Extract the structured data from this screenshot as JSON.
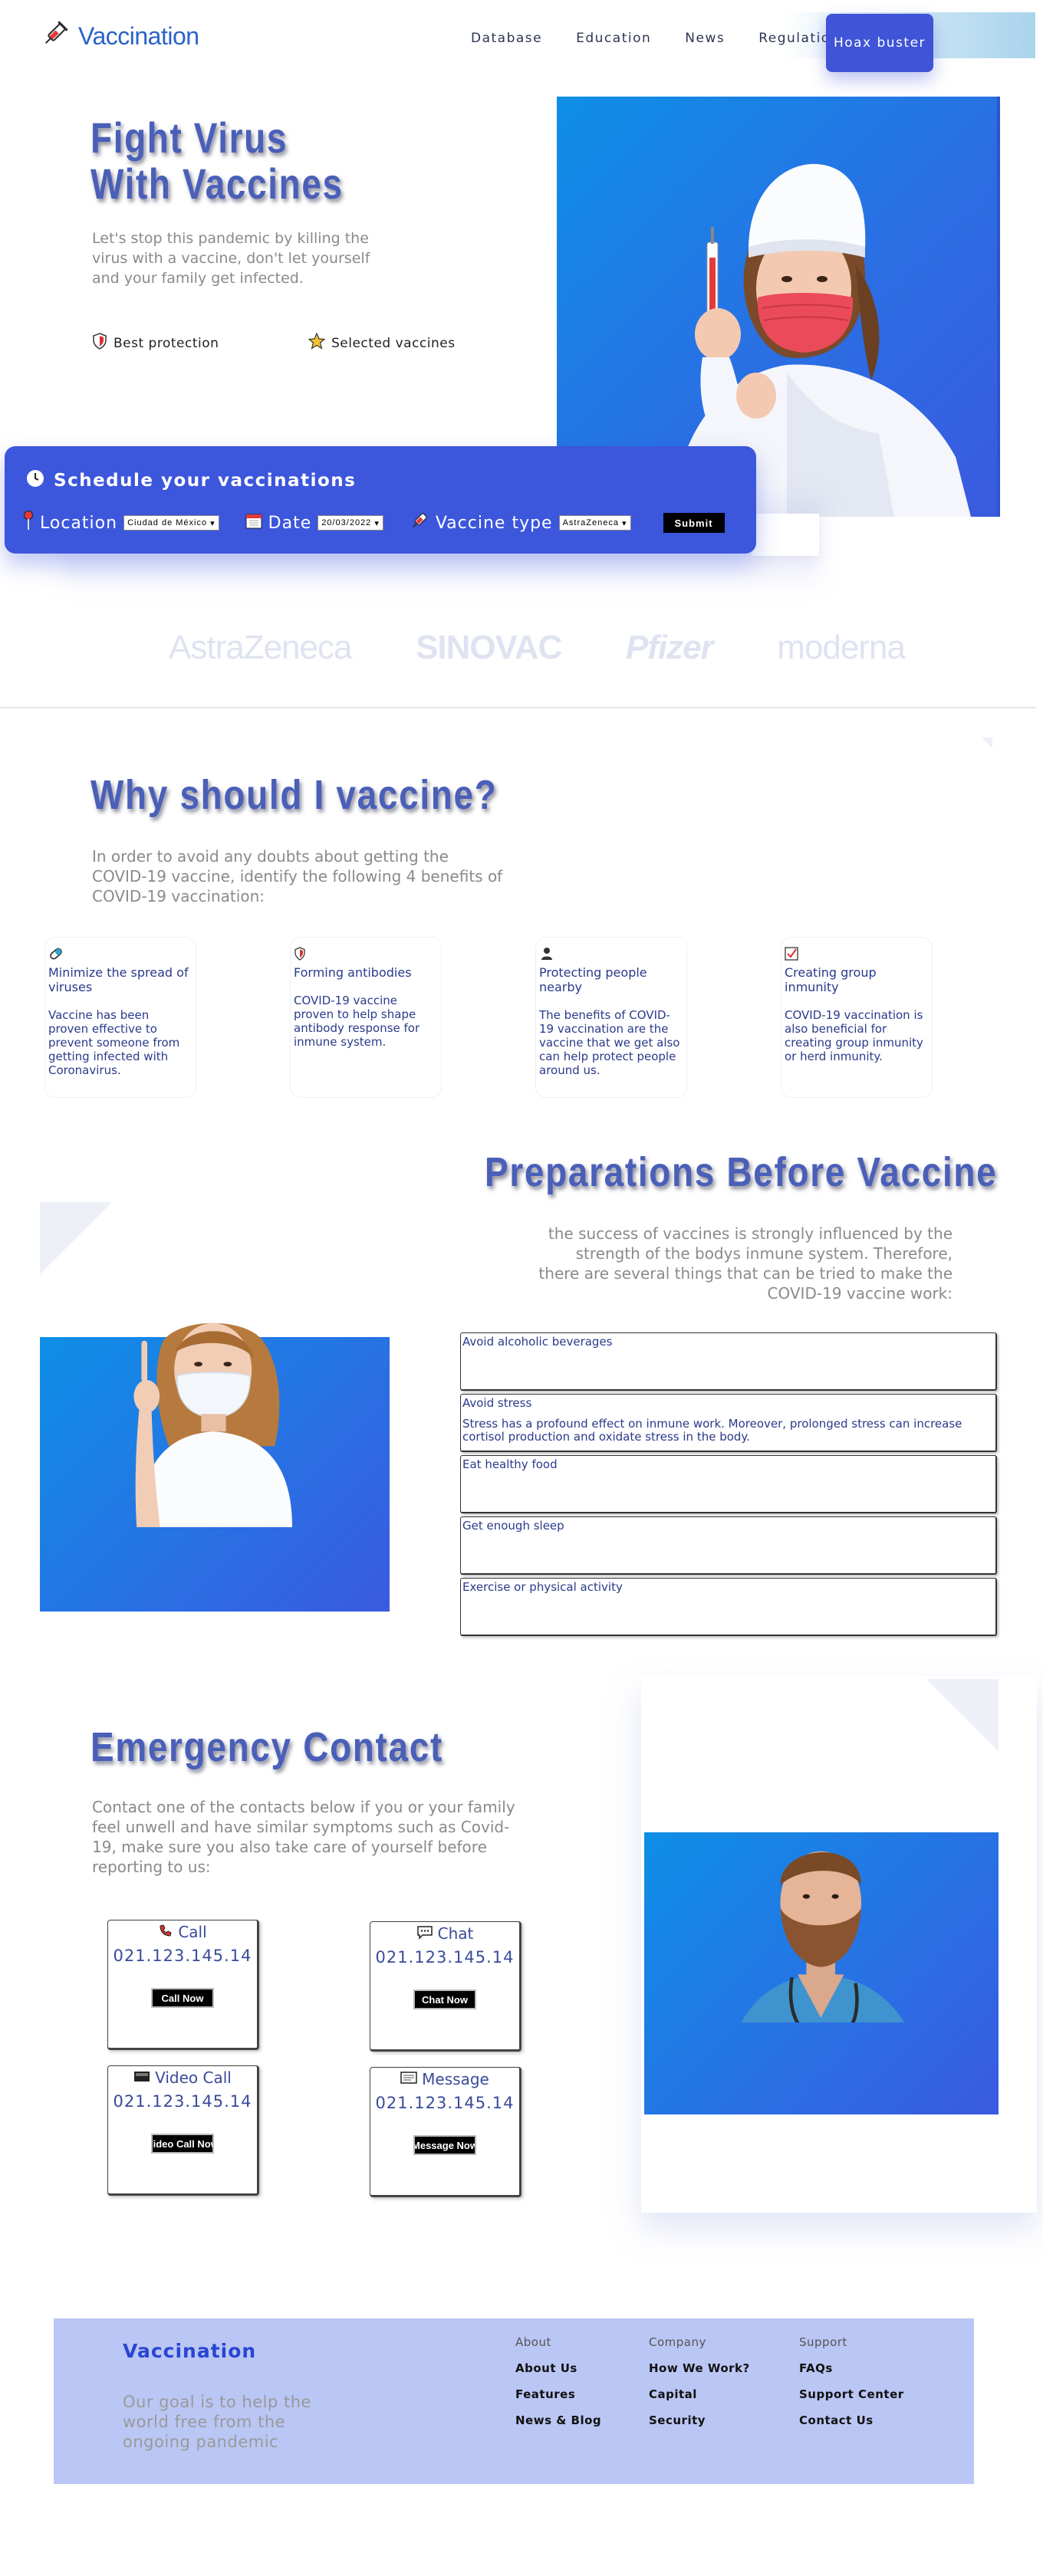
{
  "nav": {
    "logo": "Vaccination",
    "links": [
      "Database",
      "Education",
      "News",
      "Regulation"
    ],
    "cta": "Hoax buster"
  },
  "hero": {
    "title_line1": "Fight Virus",
    "title_line2": "With Vaccines",
    "description": "Let's stop this pandemic by killing the virus with a vaccine, don't let yourself and your family get infected.",
    "features": [
      "Best  protection",
      "Selected  vaccines"
    ]
  },
  "schedule": {
    "title": "Schedule your vaccinations",
    "location_label": "Location",
    "location_value": "Ciudad de México",
    "date_label": "Date",
    "date_value": "20/03/2022",
    "vaccine_label": "Vaccine type",
    "vaccine_value": "AstraZeneca",
    "submit": "Submit"
  },
  "brands": [
    "AstraZeneca",
    "SINOVAC",
    "Pfizer",
    "moderna"
  ],
  "why": {
    "title": "Why should I vaccine?",
    "description": "In order to avoid any doubts about getting the COVID-19 vaccine, identify the following 4 benefits of COVID-19 vaccination:",
    "cards": [
      {
        "title": "Minimize the spread of viruses",
        "body": "Vaccine has been proven effective to prevent someone from getting infected with Coronavirus."
      },
      {
        "title": "Forming antibodies",
        "body": "COVID-19 vaccine proven to help shape antibody response for inmune system."
      },
      {
        "title": "Protecting people nearby",
        "body": "The benefits of COVID-19 vaccination are the vaccine that we get also can help protect people around us."
      },
      {
        "title": "Creating group inmunity",
        "body": "COVID-19 vaccination is also beneficial for creating group inmunity or herd inmunity."
      }
    ]
  },
  "prep": {
    "title": "Preparations Before Vaccine",
    "description": "the success of vaccines is strongly influenced by the strength of the bodys inmune system. Therefore, there are several things that can be tried to make the COVID-19 vaccine work:",
    "items": [
      {
        "q": "Avoid alcoholic beverages",
        "a": ""
      },
      {
        "q": "Avoid stress",
        "a": "Stress has a profound effect on inmune work. Moreover, prolonged stress can increase cortisol production and oxidate stress in the body."
      },
      {
        "q": "Eat healthy food",
        "a": ""
      },
      {
        "q": "Get enough sleep",
        "a": ""
      },
      {
        "q": "Exercise or physical activity",
        "a": ""
      }
    ]
  },
  "emergency": {
    "title": "Emergency Contact",
    "description": "Contact one of the contacts below if you or your family feel unwell and have similar symptoms such as Covid-19, make sure you also take care of yourself before reporting to us:",
    "cards": [
      {
        "title": "Call",
        "number": "021.123.145.14",
        "button": "Call Now"
      },
      {
        "title": "Chat",
        "number": "021.123.145.14",
        "button": "Chat Now"
      },
      {
        "title": "Video Call",
        "number": "021.123.145.14",
        "button": "Video Call Now"
      },
      {
        "title": "Message",
        "number": "021.123.145.14",
        "button": "Message Now"
      }
    ]
  },
  "footer": {
    "brand": "Vaccination",
    "description": "Our goal is to help the world free from the ongoing pandemic",
    "columns": [
      {
        "head": "About",
        "items": [
          "About Us",
          "Features",
          "News & Blog"
        ]
      },
      {
        "head": "Company",
        "items": [
          "How We Work?",
          "Capital",
          "Security"
        ]
      },
      {
        "head": "Support",
        "items": [
          "FAQs",
          "Support Center",
          "Contact Us"
        ]
      }
    ]
  },
  "colors": {
    "primary": "#3c56dc",
    "title": "#4a5fb8",
    "footer_bg": "#bac6f4",
    "image_bg": "#2a6fe4"
  }
}
